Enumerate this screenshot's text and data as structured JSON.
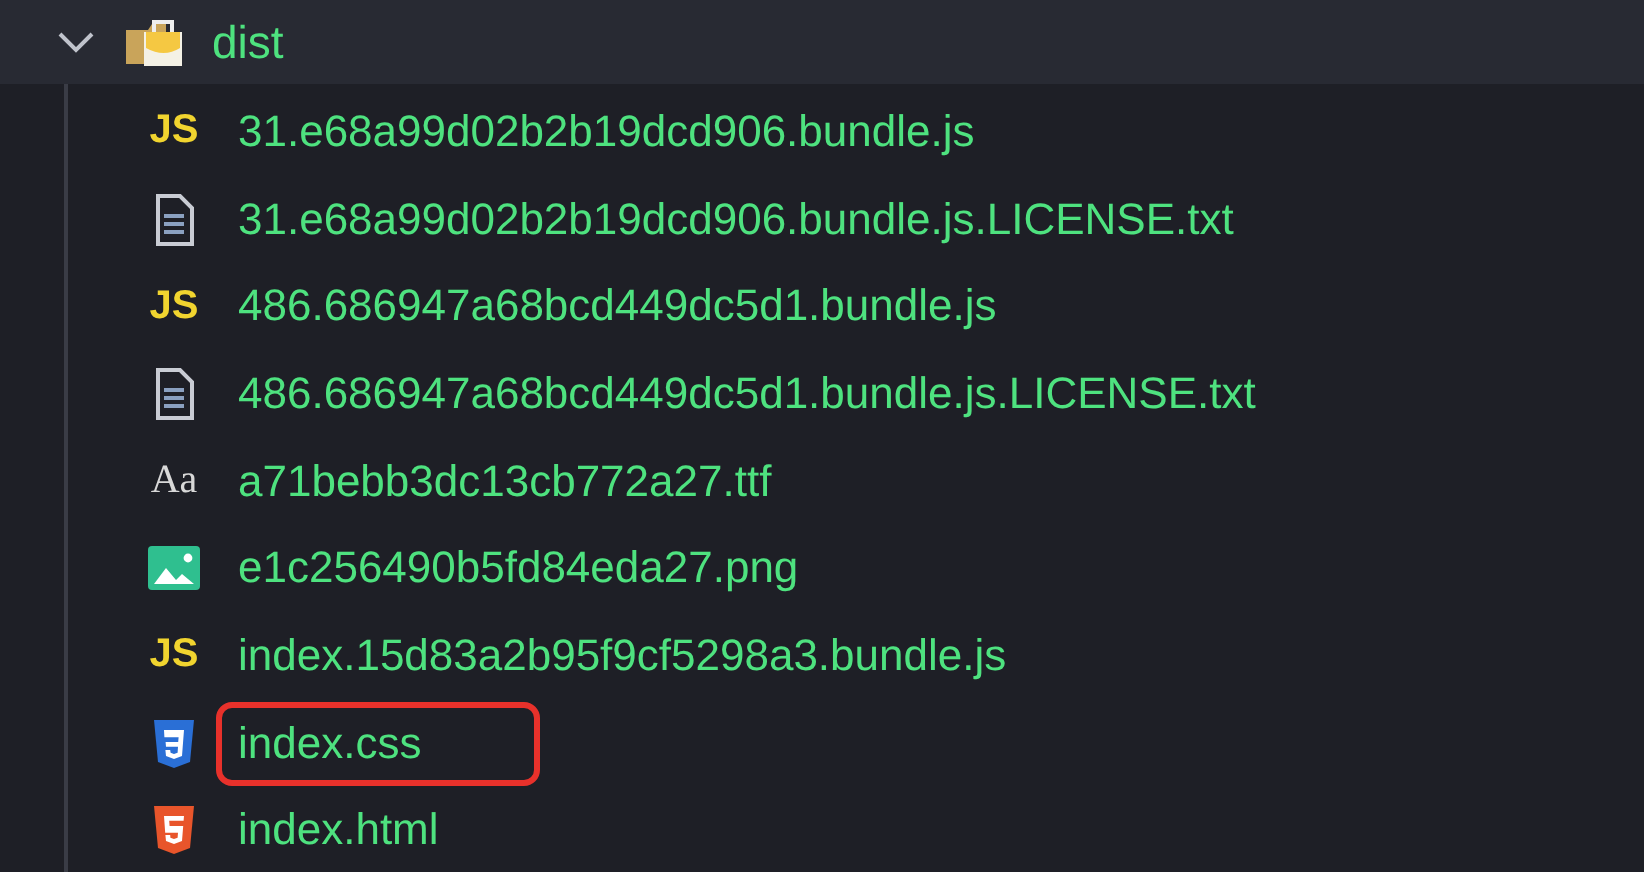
{
  "folder": {
    "name": "dist",
    "expanded": true
  },
  "files": [
    {
      "name": "31.e68a99d02b2b19dcd906.bundle.js",
      "kind": "js",
      "badge": "JS",
      "highlighted": false
    },
    {
      "name": "31.e68a99d02b2b19dcd906.bundle.js.LICENSE.txt",
      "kind": "text",
      "highlighted": false
    },
    {
      "name": "486.686947a68bcd449dc5d1.bundle.js",
      "kind": "js",
      "badge": "JS",
      "highlighted": false
    },
    {
      "name": "486.686947a68bcd449dc5d1.bundle.js.LICENSE.txt",
      "kind": "text",
      "highlighted": false
    },
    {
      "name": "a71bebb3dc13cb772a27.ttf",
      "kind": "font",
      "badge": "Aa",
      "highlighted": false
    },
    {
      "name": "e1c256490b5fd84eda27.png",
      "kind": "image",
      "highlighted": false
    },
    {
      "name": "index.15d83a2b95f9cf5298a3.bundle.js",
      "kind": "js",
      "badge": "JS",
      "highlighted": false
    },
    {
      "name": "index.css",
      "kind": "css",
      "highlighted": true
    },
    {
      "name": "index.html",
      "kind": "html",
      "highlighted": false
    }
  ]
}
